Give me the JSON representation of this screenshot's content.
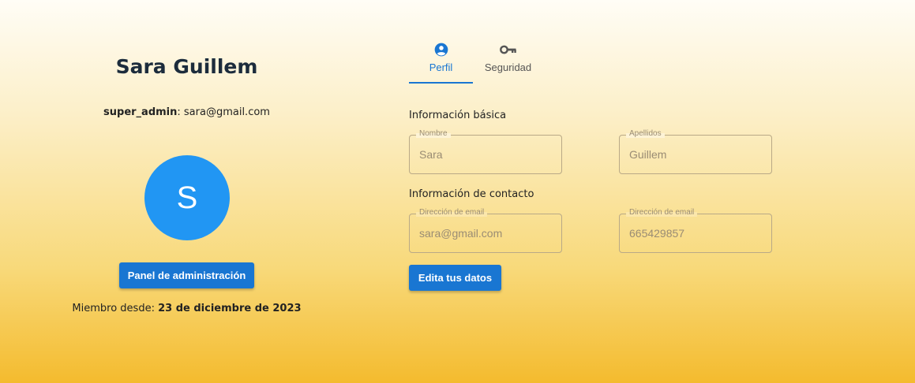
{
  "profile": {
    "name": "Sara Guillem",
    "role": "super_admin",
    "email": "sara@gmail.com",
    "avatar_initial": "S",
    "admin_button_label": "Panel de administración",
    "member_since_label": "Miembro desde:",
    "member_since_date": "23 de diciembre de 2023"
  },
  "tabs": [
    {
      "label": "Perfil",
      "icon": "account-circle-icon",
      "active": true
    },
    {
      "label": "Seguridad",
      "icon": "key-icon",
      "active": false
    }
  ],
  "form": {
    "basic_title": "Información básica",
    "contact_title": "Información de contacto",
    "fields": {
      "nombre": {
        "label": "Nombre",
        "value": "Sara"
      },
      "apellidos": {
        "label": "Apellidos",
        "value": "Guillem"
      },
      "email": {
        "label": "Dirección de email",
        "value": "sara@gmail.com"
      },
      "phone": {
        "label": "Dirección de email",
        "value": "665429857"
      }
    },
    "edit_button_label": "Edita tus datos"
  },
  "colors": {
    "accent": "#1976d2",
    "avatar": "#2196f3",
    "gradient_top": "#fffdf6",
    "gradient_bottom": "#f4bb2e"
  }
}
